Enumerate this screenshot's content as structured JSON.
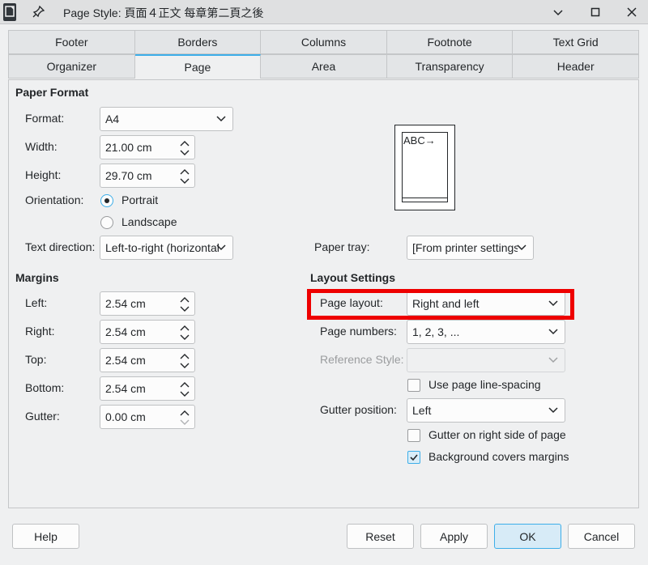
{
  "window": {
    "title": "Page Style: 頁面４正文 每章第二頁之後",
    "icons": {
      "app": "document-icon",
      "pin": "pin-icon",
      "minimize": "minimize-icon",
      "maximize": "maximize-icon",
      "close": "close-icon"
    }
  },
  "tabs": {
    "row1": [
      "Footer",
      "Borders",
      "Columns",
      "Footnote",
      "Text Grid"
    ],
    "row2": [
      "Organizer",
      "Page",
      "Area",
      "Transparency",
      "Header"
    ],
    "active": "Page"
  },
  "paper_format": {
    "title": "Paper Format",
    "format_label": "Format:",
    "format_value": "A4",
    "width_label": "Width:",
    "width_value": "21.00 cm",
    "height_label": "Height:",
    "height_value": "29.70 cm",
    "orientation_label": "Orientation:",
    "portrait_label": "Portrait",
    "landscape_label": "Landscape",
    "orientation_selected": "Portrait",
    "text_direction_label": "Text direction:",
    "text_direction_value": "Left-to-right (horizontal",
    "paper_tray_label": "Paper tray:",
    "paper_tray_value": "[From printer settings]",
    "preview_text": "ABC→"
  },
  "margins": {
    "title": "Margins",
    "left_label": "Left:",
    "left_value": "2.54 cm",
    "right_label": "Right:",
    "right_value": "2.54 cm",
    "top_label": "Top:",
    "top_value": "2.54 cm",
    "bottom_label": "Bottom:",
    "bottom_value": "2.54 cm",
    "gutter_label": "Gutter:",
    "gutter_value": "0.00 cm"
  },
  "layout_settings": {
    "title": "Layout Settings",
    "page_layout_label": "Page layout:",
    "page_layout_value": "Right and left",
    "page_numbers_label": "Page numbers:",
    "page_numbers_value": "1, 2, 3, ...",
    "reference_style_label": "Reference Style:",
    "reference_style_value": "",
    "use_line_spacing_label": "Use page line-spacing",
    "use_line_spacing_checked": false,
    "gutter_position_label": "Gutter position:",
    "gutter_position_value": "Left",
    "gutter_right_label": "Gutter on right side of page",
    "gutter_right_checked": false,
    "background_covers_label": "Background covers margins",
    "background_covers_checked": true,
    "highlight_color": "#ee0000"
  },
  "buttons": {
    "help": "Help",
    "reset": "Reset",
    "apply": "Apply",
    "ok": "OK",
    "cancel": "Cancel"
  }
}
